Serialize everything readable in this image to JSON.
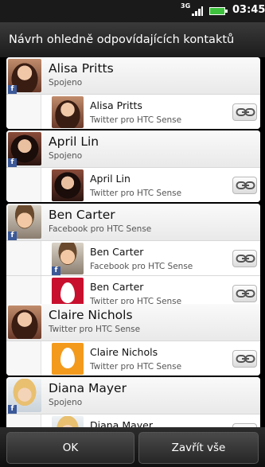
{
  "status_bar": {
    "network": "3G",
    "time": "03:45"
  },
  "dialog": {
    "title": "Návrh ohledně odpovídajících kontaktů"
  },
  "groups": [
    {
      "name": "Alisa Pritts",
      "subtitle": "Spojeno",
      "facebook_badge": "f",
      "children": [
        {
          "name": "Alisa Pritts",
          "source": "Twitter pro HTC Sense"
        }
      ]
    },
    {
      "name": "April Lin",
      "subtitle": "Spojeno",
      "facebook_badge": "f",
      "children": [
        {
          "name": "April Lin",
          "source": "Twitter pro HTC Sense"
        }
      ]
    },
    {
      "name": "Ben Carter",
      "subtitle": "Facebook pro HTC Sense",
      "facebook_badge": "f",
      "children": [
        {
          "name": "Ben Carter",
          "source": "Facebook pro HTC Sense",
          "facebook_badge": "f"
        },
        {
          "name": "Ben Carter",
          "source": "Twitter pro HTC Sense"
        }
      ]
    },
    {
      "name": "Claire Nichols",
      "subtitle": "Twitter pro HTC Sense",
      "children": [
        {
          "name": "Claire Nichols",
          "source": "Twitter pro HTC Sense"
        }
      ]
    },
    {
      "name": "Diana Mayer",
      "subtitle": "Spojeno",
      "facebook_badge": "f",
      "children": [
        {
          "name": "Diana Mayer",
          "source": ""
        }
      ]
    }
  ],
  "buttons": {
    "ok": "OK",
    "close_all": "Zavřít vše"
  },
  "icons": {
    "link": "link-chain-icon",
    "facebook": "facebook-icon",
    "battery": "battery-icon",
    "signal": "signal-icon"
  }
}
